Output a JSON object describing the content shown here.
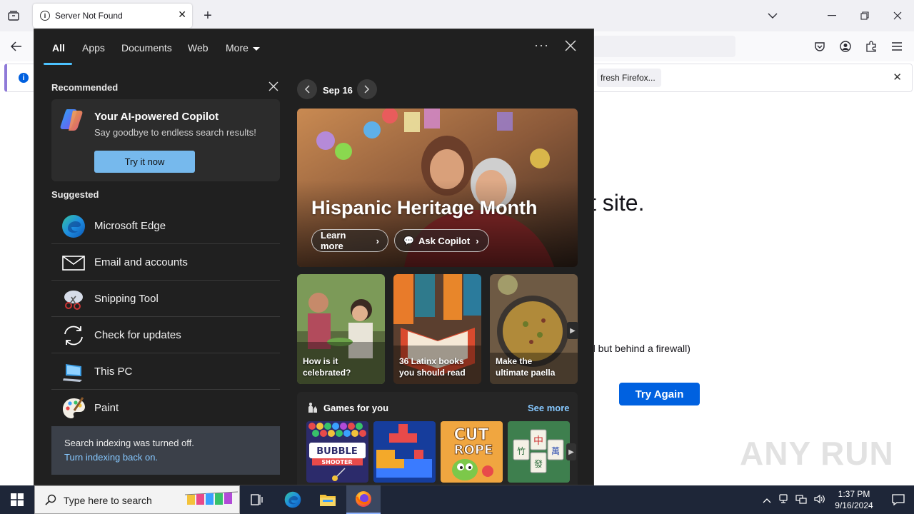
{
  "firefox": {
    "tab_title": "Server Not Found",
    "tab_info_glyph": "i",
    "new_tab_glyph": "+",
    "notification_button_label": "fresh Firefox...",
    "error_heading": "t site.",
    "error_detail": "d but behind a firewall)",
    "try_again_label": "Try Again",
    "watermark": "ANY RUN"
  },
  "search_panel": {
    "tabs": [
      "All",
      "Apps",
      "Documents",
      "Web",
      "More"
    ],
    "active_tab": "All",
    "recommended_title": "Recommended",
    "copilot": {
      "title": "Your AI-powered Copilot",
      "subtitle": "Say goodbye to endless search results!",
      "button_label": "Try it now"
    },
    "suggested_title": "Suggested",
    "suggested": [
      {
        "label": "Microsoft Edge",
        "icon": "edge-icon"
      },
      {
        "label": "Email and accounts",
        "icon": "mail-icon"
      },
      {
        "label": "Snipping Tool",
        "icon": "snipping-tool-icon"
      },
      {
        "label": "Check for updates",
        "icon": "refresh-icon"
      },
      {
        "label": "This PC",
        "icon": "this-pc-icon"
      },
      {
        "label": "Paint",
        "icon": "paint-icon"
      }
    ],
    "indexing": {
      "text": "Search indexing was turned off.",
      "link": "Turn indexing back on."
    },
    "date_label": "Sep 16",
    "hero": {
      "title": "Hispanic Heritage Month",
      "learn_more": "Learn more",
      "ask_copilot": "Ask Copilot"
    },
    "cards": [
      {
        "line1": "How is it",
        "line2": "celebrated?"
      },
      {
        "line1": "36 Latinx books",
        "line2": "you should read"
      },
      {
        "line1": "Make the",
        "line2": "ultimate paella"
      }
    ],
    "games": {
      "title": "Games for you",
      "see_more": "See more",
      "items": [
        "Bubble Shooter HD",
        "Block puzzle",
        "Cut the Rope",
        "Mahjong"
      ]
    }
  },
  "taskbar": {
    "search_placeholder": "Type here to search",
    "time": "1:37 PM",
    "date": "9/16/2024"
  },
  "colors": {
    "accent": "#4cc2ff",
    "copilot_button": "#76b9ed",
    "firefox_try_again": "#0061e0",
    "panel_bg": "#202020",
    "taskbar_bg": "#1e2638"
  }
}
